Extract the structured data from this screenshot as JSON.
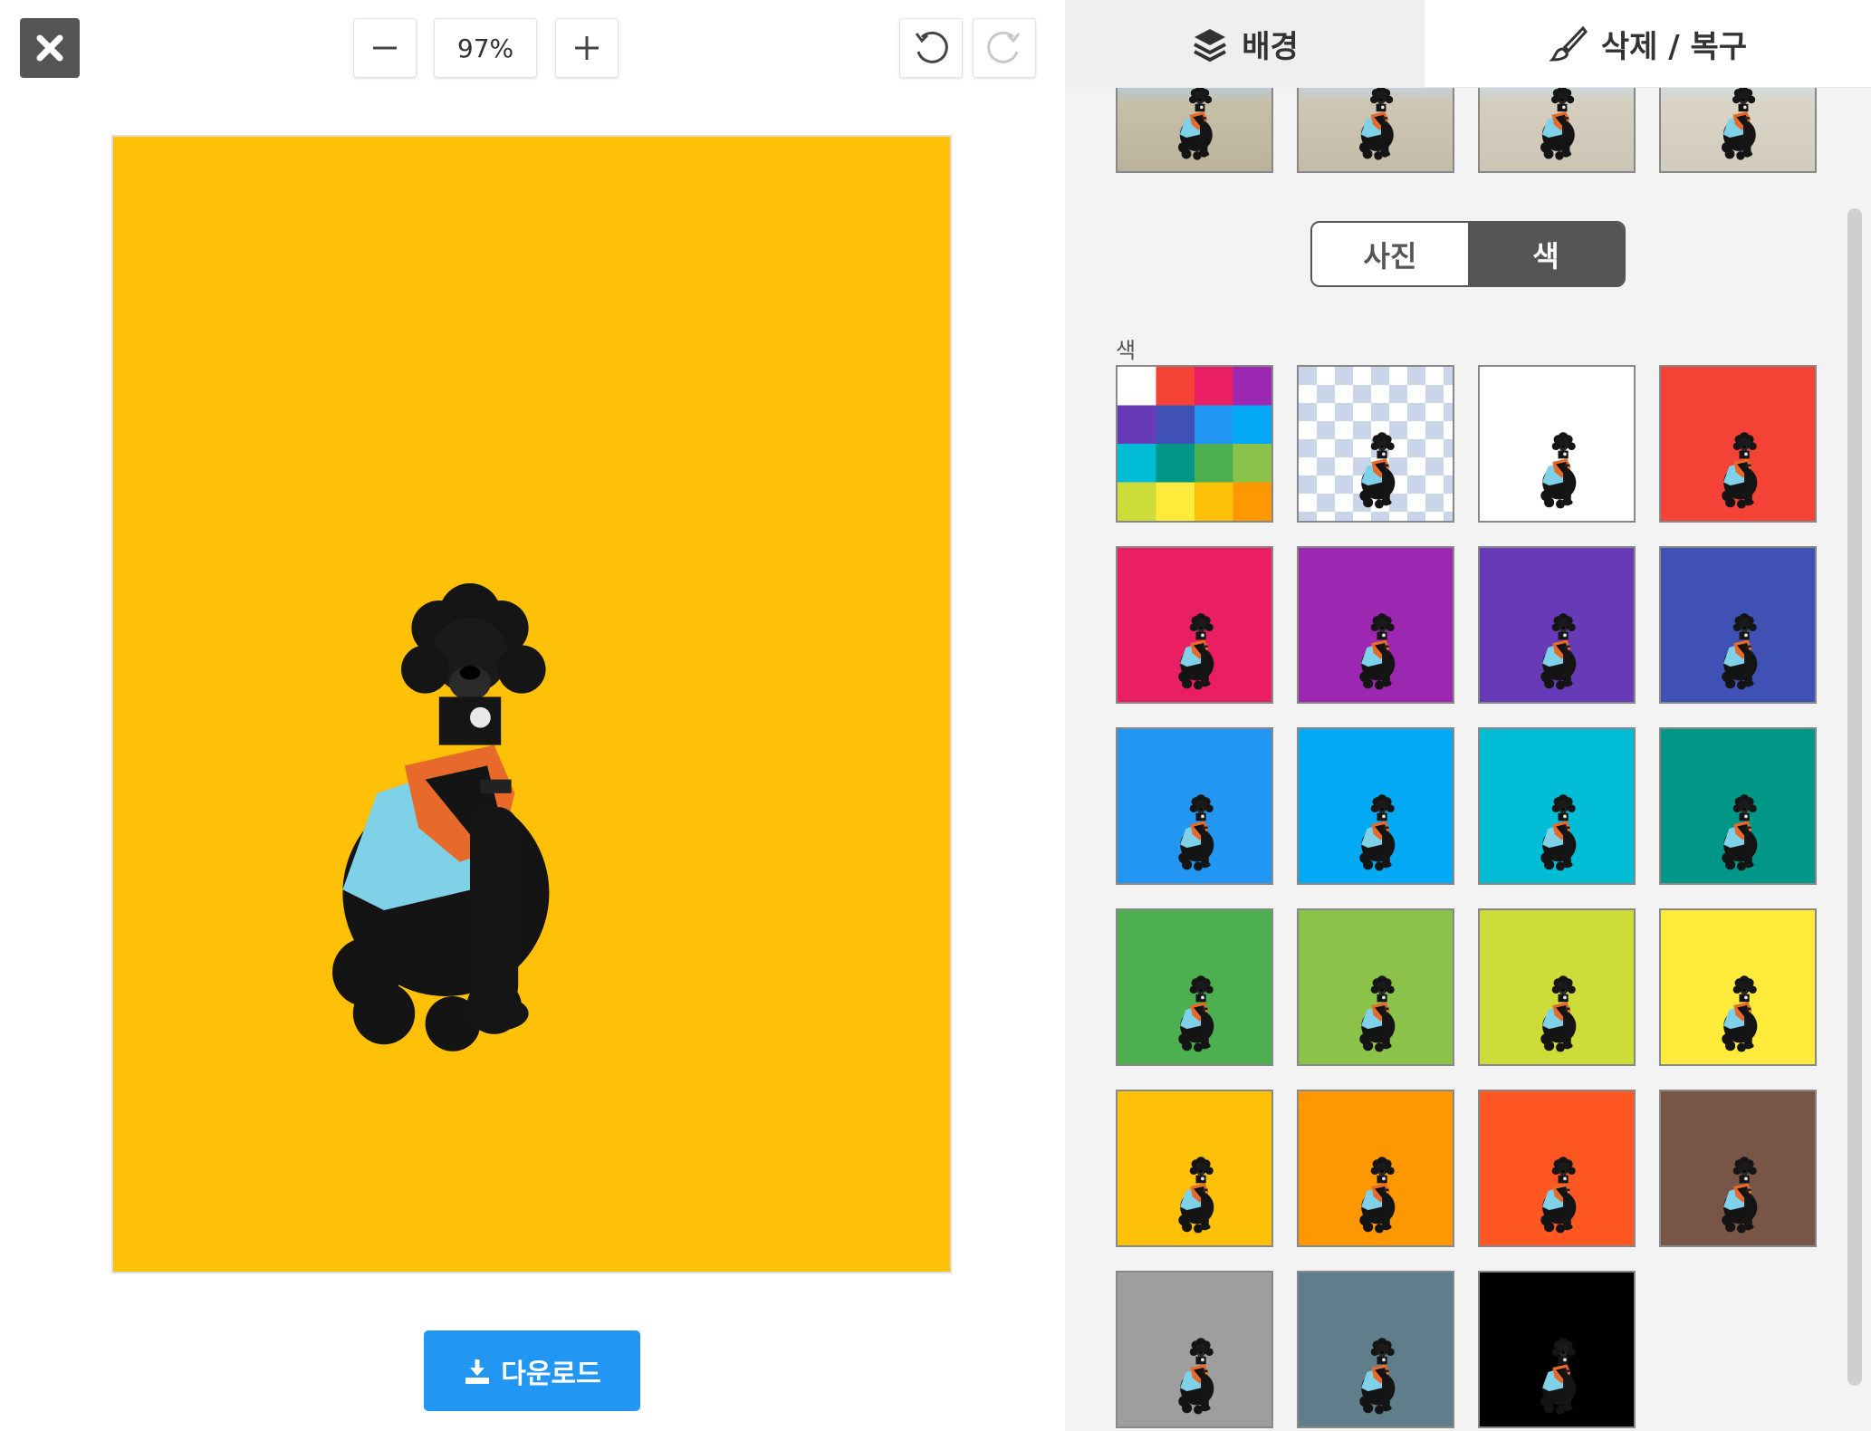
{
  "toolbar": {
    "close_icon": "close-icon",
    "zoom_out_icon": "minus-icon",
    "zoom_level": "97%",
    "zoom_in_icon": "plus-icon",
    "undo_icon": "undo-icon",
    "redo_icon": "redo-icon"
  },
  "canvas": {
    "background_color": "#FFC107"
  },
  "download": {
    "label": "다운로드",
    "icon": "download-icon"
  },
  "tabs": [
    {
      "label": "배경",
      "icon": "layers-icon"
    },
    {
      "label": "삭제 / 복구",
      "icon": "brush-icon"
    }
  ],
  "segment": {
    "photo_label": "사진",
    "color_label": "색",
    "selected": "색"
  },
  "section_label": "색",
  "photo_backgrounds": [
    "beach",
    "beach-blur-1",
    "beach-blur-2",
    "beach-blur-3"
  ],
  "color_swatches": [
    {
      "type": "palette"
    },
    {
      "type": "transparent"
    },
    {
      "type": "color",
      "color": "#FFFFFF"
    },
    {
      "type": "color",
      "color": "#F44336"
    },
    {
      "type": "color",
      "color": "#E91E63"
    },
    {
      "type": "color",
      "color": "#9C27B0"
    },
    {
      "type": "color",
      "color": "#673AB7"
    },
    {
      "type": "color",
      "color": "#3F51B5"
    },
    {
      "type": "color",
      "color": "#2196F3"
    },
    {
      "type": "color",
      "color": "#03A9F4"
    },
    {
      "type": "color",
      "color": "#00BCD4"
    },
    {
      "type": "color",
      "color": "#009688"
    },
    {
      "type": "color",
      "color": "#4CAF50"
    },
    {
      "type": "color",
      "color": "#8BC34A"
    },
    {
      "type": "color",
      "color": "#CDDC39"
    },
    {
      "type": "color",
      "color": "#FFEB3B"
    },
    {
      "type": "color",
      "color": "#FFC107"
    },
    {
      "type": "color",
      "color": "#FF9800"
    },
    {
      "type": "color",
      "color": "#FF5722"
    },
    {
      "type": "color",
      "color": "#795548"
    },
    {
      "type": "color",
      "color": "#9E9E9E"
    },
    {
      "type": "color",
      "color": "#607D8B"
    },
    {
      "type": "color",
      "color": "#000000"
    }
  ],
  "palette_colors": [
    "#FFFFFF",
    "#F44336",
    "#E91E63",
    "#9C27B0",
    "#673AB7",
    "#3F51B5",
    "#2196F3",
    "#03A9F4",
    "#00BCD4",
    "#009688",
    "#4CAF50",
    "#8BC34A",
    "#CDDC39",
    "#FFEB3B",
    "#FFC107",
    "#FF9800"
  ]
}
